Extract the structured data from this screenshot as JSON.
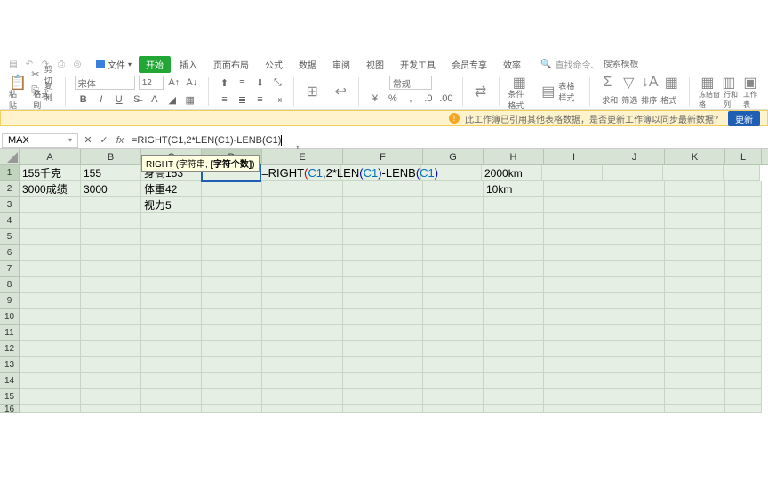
{
  "menubar": {
    "file": "文件",
    "tabs": [
      "开始",
      "插入",
      "页面布局",
      "公式",
      "数据",
      "审阅",
      "视图",
      "开发工具",
      "会员专享",
      "效率"
    ],
    "active_tab": 0,
    "search_placeholder": "搜索模板",
    "search_hint": "直找命令、"
  },
  "toolbar": {
    "cut": "剪切",
    "copy": "复制",
    "paste": "粘贴",
    "format_painter": "格式刷",
    "font_name": "宋体",
    "font_size": "12",
    "number_format": "常规",
    "conditional": "条件格式",
    "cell_styles": "表格样式",
    "sum": "求和",
    "sort": "排序",
    "filter": "筛选",
    "format": "格式",
    "freeze": "冻结窗格",
    "rowcol": "行和列",
    "worksheet": "工作表"
  },
  "warning": {
    "text": "此工作簿已引用其他表格数据，是否更新工作簿以同步最新数据？",
    "button": "更新"
  },
  "formula_bar": {
    "namebox": "MAX",
    "formula": "=RIGHT(C1,2*LEN(C1)-LENB(C1)"
  },
  "hint": {
    "text_prefix": "RIGHT (字符串, ",
    "text_bold": "[字符个数]",
    "text_suffix": ")"
  },
  "columns": [
    "A",
    "B",
    "C",
    "D",
    "E",
    "F",
    "G",
    "H",
    "I",
    "J",
    "K",
    "L"
  ],
  "active_col": "D",
  "active_row": 1,
  "cells": {
    "A1": "155千克",
    "B1": "155",
    "C1": "身高153",
    "H1": "2000km",
    "A2": "3000成绩",
    "B2": "3000",
    "C2": "体重42",
    "H2": "10km",
    "C3": "视力5"
  },
  "editing_cell_display": {
    "prefix": "=RIGHT",
    "p1o": "(",
    "r1": "C1",
    "mid1": ",2*LEN",
    "p2o": "(",
    "r2": "C1",
    "p2c": ")",
    "mid2": "-LENB",
    "p3o": "(",
    "r3": "C1",
    "p3c": ")"
  },
  "chart_data": {
    "type": "table",
    "columns": [
      "A",
      "B",
      "C",
      "D",
      "E",
      "F",
      "G",
      "H"
    ],
    "rows": [
      [
        "155千克",
        "155",
        "身高153",
        "=RIGHT(C1,2*LEN(C1)-LENB(C1)",
        "",
        "",
        "",
        "2000km"
      ],
      [
        "3000成绩",
        "3000",
        "体重42",
        "",
        "",
        "",
        "",
        "10km"
      ],
      [
        "",
        "",
        "视力5",
        "",
        "",
        "",
        "",
        ""
      ]
    ]
  }
}
